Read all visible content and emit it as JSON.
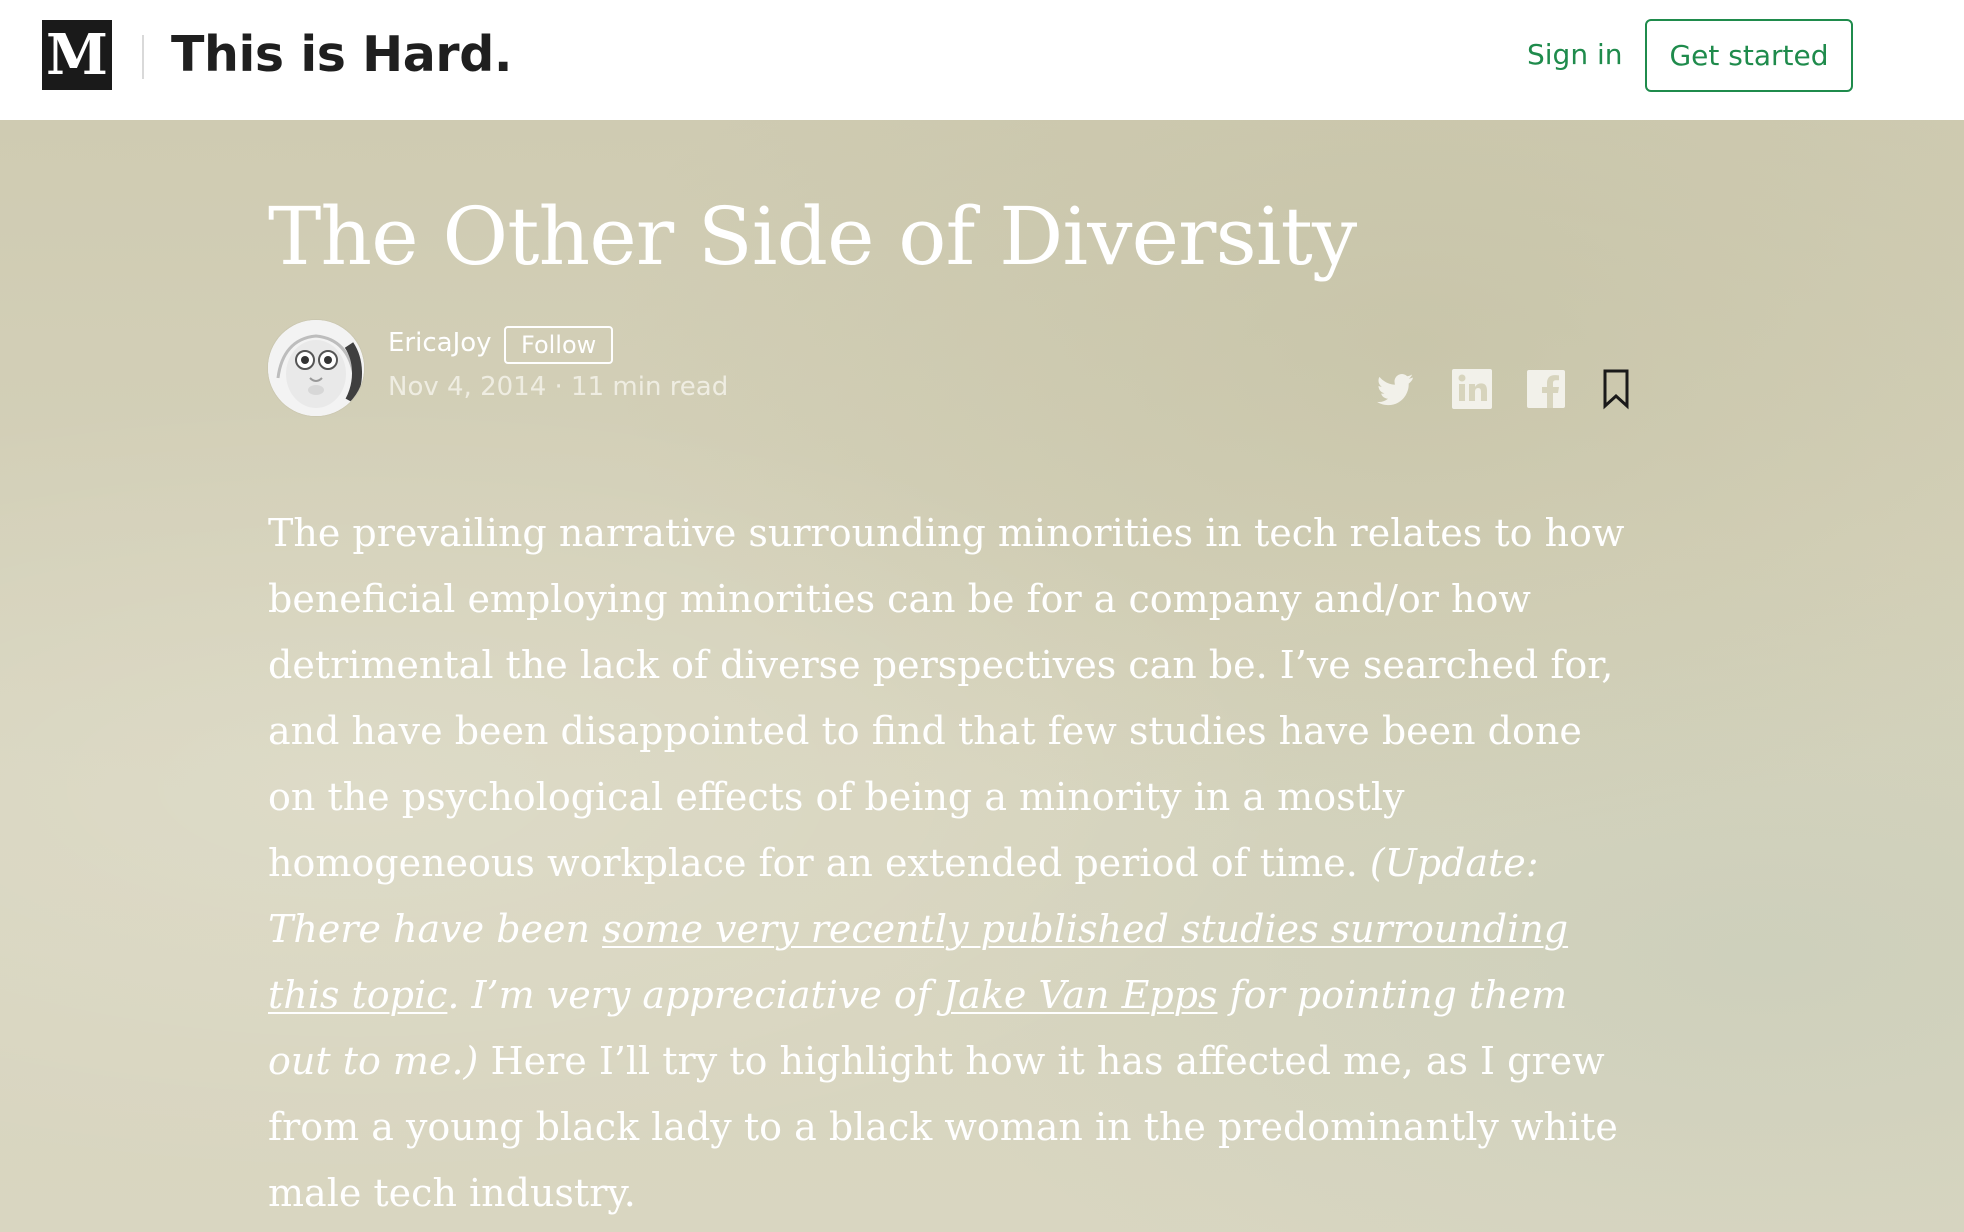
{
  "header": {
    "logo_letter": "M",
    "publication": "This is Hard.",
    "signin_label": "Sign in",
    "get_started_label": "Get started"
  },
  "article": {
    "title": "The Other Side of Diversity",
    "author": "EricaJoy",
    "follow_label": "Follow",
    "date": "Nov 4, 2014",
    "read_time": "11 min read",
    "meta_separator": " · ",
    "paragraph": {
      "intro": "The prevailing narrative surrounding minorities in tech relates to how beneficial employing minorities can be for a company and/or how detrimental the lack of diverse perspectives can be. I’ve searched for, and have been disappointed to find that few studies have been done on the psychological effects of being a minority in a mostly homogeneous workplace for an extended period of time.",
      "update_open": "(Update: There have been ",
      "update_link": "some very recently published studies surrounding this topic",
      "update_mid": ". I’m very appreciative of ",
      "person_link": "Jake Van Epps",
      "update_close": " for pointing them out to me.)",
      "outro": "Here I’ll try to highlight how it has affected me, as I grew from a young black lady to a black woman in the predominantly white male tech industry."
    }
  },
  "share_icons": [
    "twitter-icon",
    "linkedin-icon",
    "facebook-icon",
    "bookmark-icon"
  ],
  "colors": {
    "accent": "#1f8b4c",
    "hero_text": "#ffffff"
  }
}
